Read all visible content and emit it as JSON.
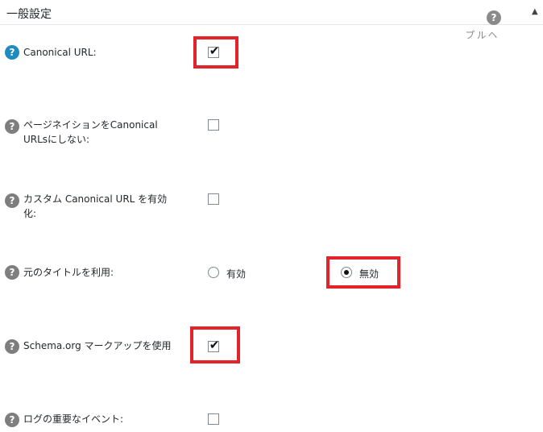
{
  "panel": {
    "title": "一般設定",
    "toggle_glyph": "▲",
    "help_label": "ヘルプ"
  },
  "settings": [
    {
      "label": "Canonical URL:",
      "control": "checkbox",
      "checked": true,
      "help_color": "#1e8cbe"
    },
    {
      "label": "ページネイションをCanonical URLsにしない:",
      "control": "checkbox",
      "checked": false
    },
    {
      "label": "カスタム Canonical URL を有効化:",
      "control": "checkbox",
      "checked": false
    },
    {
      "label": "元のタイトルを利用:",
      "control": "radio",
      "options": [
        "有効",
        "無効"
      ],
      "selected": "無効"
    },
    {
      "label": "Schema.org マークアップを使用",
      "control": "checkbox",
      "checked": true
    },
    {
      "label": "ログの重要なイベント:",
      "control": "checkbox",
      "checked": false
    }
  ],
  "icons": {
    "help": "?",
    "check": "✔"
  },
  "colors": {
    "highlight": "#e2232a",
    "help_gray": "#7e7e7e",
    "help_blue": "#1e8cbe"
  }
}
